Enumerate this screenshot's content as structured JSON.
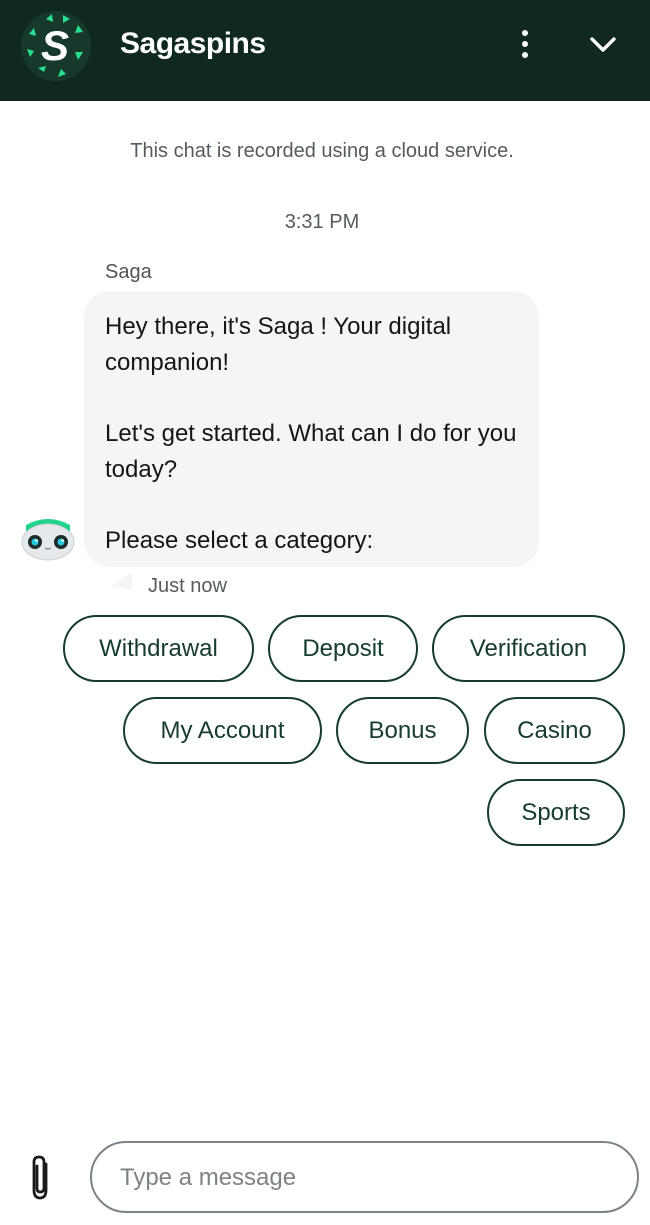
{
  "header": {
    "brand": "Sagaspins",
    "logo_letter": "S",
    "logo_icon": "sagaspins-logo-icon",
    "menu_icon": "more-vertical-icon",
    "collapse_icon": "chevron-down-icon"
  },
  "chat": {
    "notice": "This chat is recorded using a cloud service.",
    "timestamp": "3:31 PM",
    "message": {
      "sender": "Saga",
      "lines": [
        "Hey there, it's Saga ! Your digital companion!",
        "Let's get started. What can I do for you today?",
        "Please select a category:"
      ],
      "time": "Just now",
      "avatar_icon": "bot-avatar-icon"
    },
    "quick_replies": [
      "Withdrawal",
      "Deposit",
      "Verification",
      "My Account",
      "Bonus",
      "Casino",
      "Sports"
    ]
  },
  "composer": {
    "placeholder": "Type a message",
    "value": "",
    "attach_icon": "paperclip-icon"
  },
  "colors": {
    "header_bg": "#10291f",
    "accent": "#27e08f",
    "chip_border": "#163b2f",
    "bubble_bg": "#f3f5f7"
  }
}
